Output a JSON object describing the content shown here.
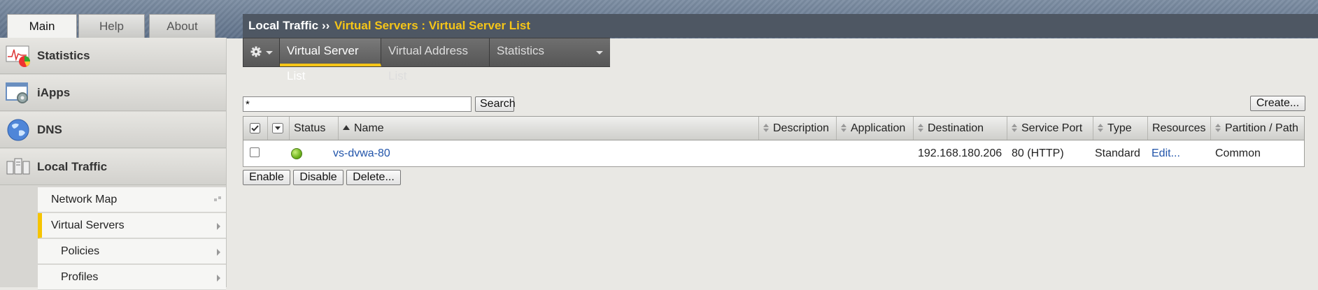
{
  "nav": {
    "tabs": [
      {
        "label": "Main",
        "active": true
      },
      {
        "label": "Help",
        "active": false
      },
      {
        "label": "About",
        "active": false
      }
    ]
  },
  "sidebar": {
    "items": [
      {
        "label": "Statistics",
        "icon": "statistics-icon"
      },
      {
        "label": "iApps",
        "icon": "iapps-icon"
      },
      {
        "label": "DNS",
        "icon": "globe-icon"
      },
      {
        "label": "Local Traffic",
        "icon": "local-traffic-icon"
      }
    ],
    "subitems": [
      {
        "label": "Network Map"
      },
      {
        "label": "Virtual Servers",
        "active": true
      },
      {
        "label": "Policies"
      },
      {
        "label": "Profiles"
      }
    ]
  },
  "breadcrumb": {
    "root": "Local Traffic",
    "separator": "››",
    "current": "Virtual Servers : Virtual Server List"
  },
  "subtabs": [
    {
      "label": "Virtual Server List",
      "active": true
    },
    {
      "label": "Virtual Address List",
      "active": false
    },
    {
      "label": "Statistics",
      "active": false
    }
  ],
  "search": {
    "value": "*",
    "button": "Search"
  },
  "create_button": "Create...",
  "table": {
    "columns": [
      "Status",
      "Name",
      "Description",
      "Application",
      "Destination",
      "Service Port",
      "Type",
      "Resources",
      "Partition / Path"
    ],
    "rows": [
      {
        "name": "vs-dvwa-80",
        "description": "",
        "application": "",
        "destination": "192.168.180.206",
        "service_port": "80 (HTTP)",
        "type": "Standard",
        "resources": "Edit...",
        "partition": "Common",
        "status": "available"
      }
    ]
  },
  "actions": {
    "enable": "Enable",
    "disable": "Disable",
    "delete": "Delete..."
  },
  "colors": {
    "accent": "#f5c518",
    "breadcrumb_bg": "#4e5763",
    "link": "#2255aa",
    "status_green": "#6fb31e"
  }
}
